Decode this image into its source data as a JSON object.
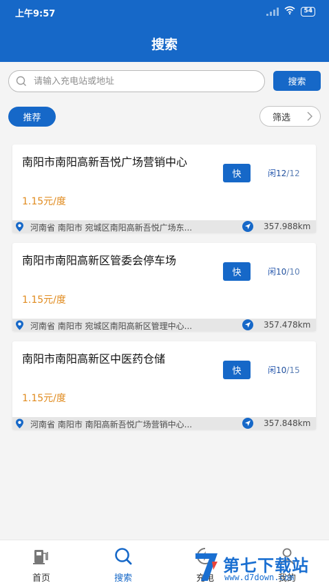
{
  "status_bar": {
    "time": "上午9:57",
    "battery": "54"
  },
  "header": {
    "title": "搜索"
  },
  "search": {
    "placeholder": "请输入充电站或地址",
    "button_label": "搜索"
  },
  "filters": {
    "recommend_label": "推荐",
    "filter_label": "筛选"
  },
  "stations": [
    {
      "name": "南阳市南阳高新吾悦广场营销中心",
      "badge": "快",
      "idle_prefix": "闲",
      "idle": "12",
      "total": "/12",
      "price": "1.15元/度",
      "address": "河南省 南阳市  宛城区南阳高新吾悦广场东...",
      "distance": "357.988km"
    },
    {
      "name": "南阳市南阳高新区管委会停车场",
      "badge": "快",
      "idle_prefix": "闲",
      "idle": "10",
      "total": "/10",
      "price": "1.15元/度",
      "address": "河南省 南阳市   宛城区南阳高新区管理中心...",
      "distance": "357.478km"
    },
    {
      "name": "南阳市南阳高新区中医药仓储",
      "badge": "快",
      "idle_prefix": "闲",
      "idle": "10",
      "total": "/15",
      "price": "1.15元/度",
      "address": "河南省 南阳市  南阳高新吾悦广场营销中心...",
      "distance": "357.848km"
    }
  ],
  "tabbar": {
    "home_label": "首页",
    "search_label": "搜索",
    "charge_label": "充电",
    "mine_label": "我的"
  },
  "watermark": {
    "text": "第七下载站",
    "url": "www.d7down.com"
  },
  "colors": {
    "primary": "#1668c8",
    "price": "#e08a1d",
    "background": "#f4f4f4"
  },
  "icons": [
    "search-icon",
    "chevron-right-icon",
    "location-pin-icon",
    "navigate-arrow-icon",
    "charging-station-icon",
    "search-tab-icon",
    "charge-tab-icon",
    "user-icon"
  ]
}
